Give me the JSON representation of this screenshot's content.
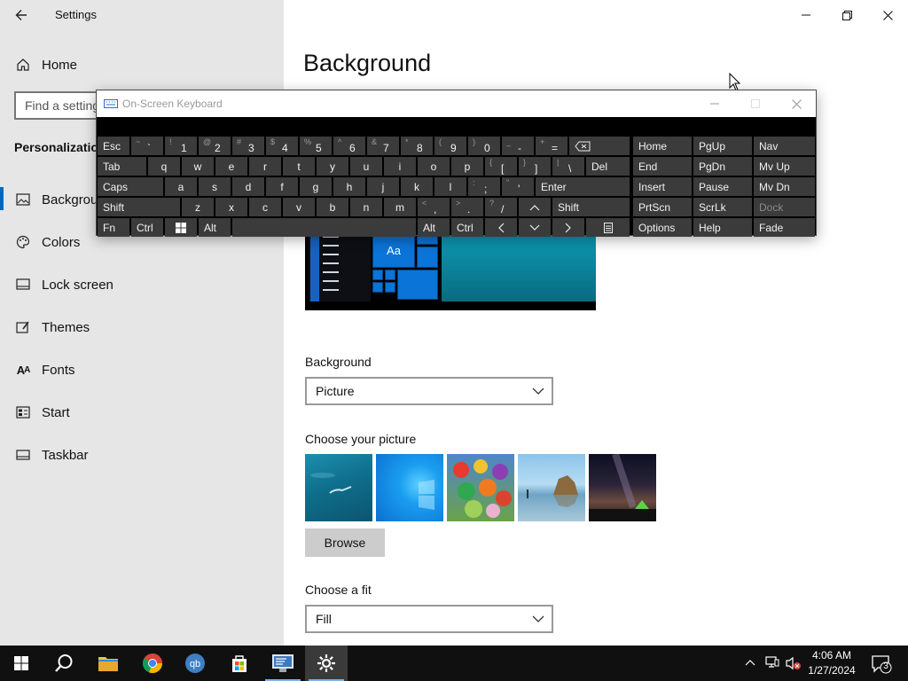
{
  "window": {
    "title": "Settings"
  },
  "sidebar": {
    "home_label": "Home",
    "search_placeholder": "Find a setting",
    "section_label": "Personalization",
    "items": [
      {
        "label": "Background",
        "icon": "picture-icon",
        "selected": true
      },
      {
        "label": "Colors",
        "icon": "palette-icon"
      },
      {
        "label": "Lock screen",
        "icon": "lock-screen-icon"
      },
      {
        "label": "Themes",
        "icon": "themes-brush-icon"
      },
      {
        "label": "Fonts",
        "icon": "fonts-icon"
      },
      {
        "label": "Start",
        "icon": "start-menu-icon"
      },
      {
        "label": "Taskbar",
        "icon": "taskbar-icon"
      }
    ]
  },
  "main": {
    "page_title": "Background",
    "preview_tile_text": "Aa",
    "background_label": "Background",
    "background_value": "Picture",
    "choose_picture_label": "Choose your picture",
    "browse_label": "Browse",
    "choose_fit_label": "Choose a fit",
    "fit_value": "Fill",
    "thumbnails": [
      "underwater-swimmer",
      "windows-blue-logo",
      "cartoon-characters",
      "beach-rock-reflection",
      "night-sky-tent"
    ]
  },
  "osk": {
    "title": "On-Screen Keyboard",
    "row1": [
      {
        "sec": "~",
        "pri": "`"
      },
      {
        "sec": "!",
        "pri": "1"
      },
      {
        "sec": "@",
        "pri": "2"
      },
      {
        "sec": "#",
        "pri": "3"
      },
      {
        "sec": "$",
        "pri": "4"
      },
      {
        "sec": "%",
        "pri": "5"
      },
      {
        "sec": "^",
        "pri": "6"
      },
      {
        "sec": "&",
        "pri": "7"
      },
      {
        "sec": "*",
        "pri": "8"
      },
      {
        "sec": "(",
        "pri": "9"
      },
      {
        "sec": ")",
        "pri": "0"
      },
      {
        "sec": "_",
        "pri": "-"
      },
      {
        "sec": "+",
        "pri": "="
      }
    ],
    "esc": "Esc",
    "tab": "Tab",
    "caps": "Caps",
    "shift": "Shift",
    "fn": "Fn",
    "ctrl": "Ctrl",
    "alt": "Alt",
    "del": "Del",
    "enter": "Enter",
    "row2": [
      "q",
      "w",
      "e",
      "r",
      "t",
      "y",
      "u",
      "i",
      "o",
      "p"
    ],
    "row2_sym": [
      {
        "sec": "{",
        "pri": "["
      },
      {
        "sec": "}",
        "pri": "]"
      },
      {
        "sec": "|",
        "pri": "\\"
      }
    ],
    "row3": [
      "a",
      "s",
      "d",
      "f",
      "g",
      "h",
      "j",
      "k",
      "l"
    ],
    "row3_sym": [
      {
        "sec": ":",
        "pri": ";"
      },
      {
        "sec": "\"",
        "pri": "'"
      }
    ],
    "row4": [
      "z",
      "x",
      "c",
      "v",
      "b",
      "n",
      "m"
    ],
    "row4_sym": [
      {
        "sec": "<",
        "pri": ","
      },
      {
        "sec": ">",
        "pri": "."
      },
      {
        "sec": "?",
        "pri": "/"
      }
    ],
    "nav": {
      "home": "Home",
      "pgup": "PgUp",
      "nav": "Nav",
      "end": "End",
      "pgdn": "PgDn",
      "mvup": "Mv Up",
      "insert": "Insert",
      "pause": "Pause",
      "mvdn": "Mv Dn",
      "prtscn": "PrtScn",
      "scrlk": "ScrLk",
      "dock": "Dock",
      "options": "Options",
      "help": "Help",
      "fade": "Fade"
    }
  },
  "taskbar": {
    "time": "4:06 AM",
    "date": "1/27/2024",
    "notification_count": "3",
    "apps": [
      "start-button",
      "search",
      "file-explorer",
      "chrome",
      "qbittorrent",
      "microsoft-store",
      "remote-desktop",
      "settings"
    ]
  }
}
